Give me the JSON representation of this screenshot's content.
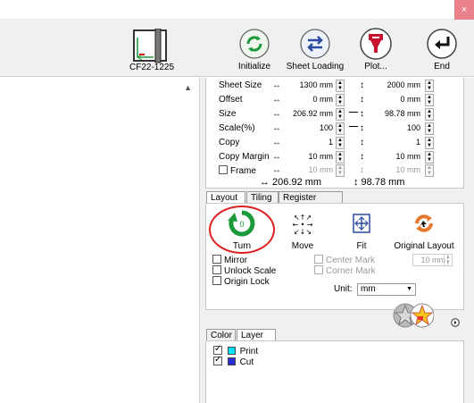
{
  "window": {
    "close_glyph": "×"
  },
  "toolbar": {
    "device_label": "CF22-1225",
    "initialize_label": "Initialize",
    "sheet_loading_label": "Sheet Loading",
    "plot_label": "Plot...",
    "end_label": "End"
  },
  "settings": {
    "sheet_size": {
      "label": "Sheet Size",
      "w": "1300 mm",
      "h": "2000 mm"
    },
    "offset": {
      "label": "Offset",
      "w": "0 mm",
      "h": "0 mm"
    },
    "size": {
      "label": "Size",
      "w": "206.92 mm",
      "h": "98.78 mm"
    },
    "scale": {
      "label": "Scale(%)",
      "w": "100",
      "h": "100"
    },
    "copy": {
      "label": "Copy",
      "w": "1",
      "h": "1"
    },
    "copy_margin": {
      "label": "Copy Margin",
      "w": "10 mm",
      "h": "10 mm"
    },
    "frame": {
      "label": "Frame",
      "w": "10 mm",
      "h": "10 mm"
    },
    "total_w": "↔ 206.92 mm",
    "total_h": "↕ 98.78 mm"
  },
  "layout_tabs": [
    "Layout",
    "Tiling",
    "Register Mark"
  ],
  "layout": {
    "turn_label": "Turn",
    "turn_badge": "0",
    "move_label": "Move",
    "fit_label": "Fit",
    "original_layout_label": "Original Layout",
    "mirror_label": "Mirror",
    "unlock_scale_label": "Unlock Scale",
    "origin_lock_label": "Origin Lock",
    "center_mark_label": "Center Mark",
    "corner_mark_label": "Corner Mark",
    "mark_size": "10 mm",
    "unit_label": "Unit:",
    "unit_value": "mm"
  },
  "layer_tabs": [
    "Color",
    "Layer"
  ],
  "layers": [
    {
      "name": "Print",
      "color": "#00e5ff",
      "checked": true
    },
    {
      "name": "Cut",
      "color": "#2b2bd6",
      "checked": true
    }
  ],
  "colors": {
    "accent_green": "#1a9a3a",
    "plot_red": "#c8102e",
    "turn_highlight": "#dd2222"
  }
}
